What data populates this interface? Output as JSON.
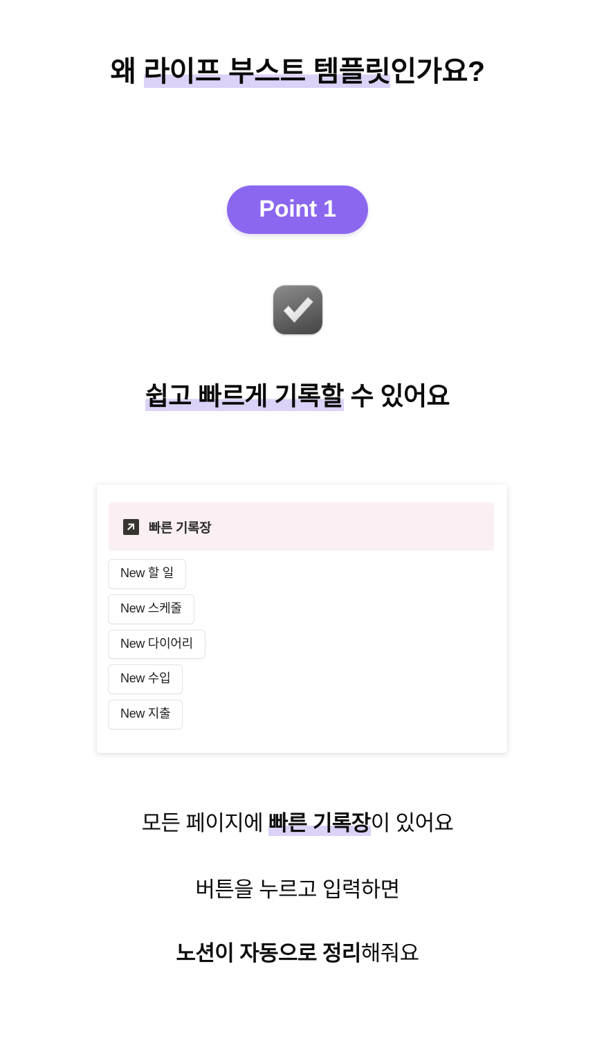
{
  "headline": {
    "prefix": "왜 ",
    "highlight": "라이프 부스트 템플릿",
    "suffix": "인가요?"
  },
  "badge": {
    "label": "Point 1"
  },
  "icon": {
    "name": "check-mark-button-emoji"
  },
  "subheading": {
    "highlight": "쉽고 빠르게 기록할",
    "suffix": " 수 있어요"
  },
  "card": {
    "banner": {
      "icon": "arrow-up-right-icon",
      "label": "빠른 기록장"
    },
    "buttons": [
      {
        "label": "New 할 일"
      },
      {
        "label": "New 스케줄"
      },
      {
        "label": "New 다이어리"
      },
      {
        "label": "New 수입"
      },
      {
        "label": "New 지출"
      }
    ]
  },
  "footer": {
    "line1": {
      "prefix": "모든 페이지에 ",
      "highlight": "빠른 기록장",
      "suffix": "이 있어요"
    },
    "line2": {
      "text": "버튼을 누르고 입력하면"
    },
    "line3": {
      "bold": "노션이 자동으로 정리",
      "suffix": "해줘요"
    }
  },
  "colors": {
    "accent_purple": "#8B67EF",
    "highlight_lavender": "#DCD2F7",
    "banner_pink": "#FAF0F4",
    "page_background": "#FFFFFF",
    "text": "#0A0A0A"
  }
}
